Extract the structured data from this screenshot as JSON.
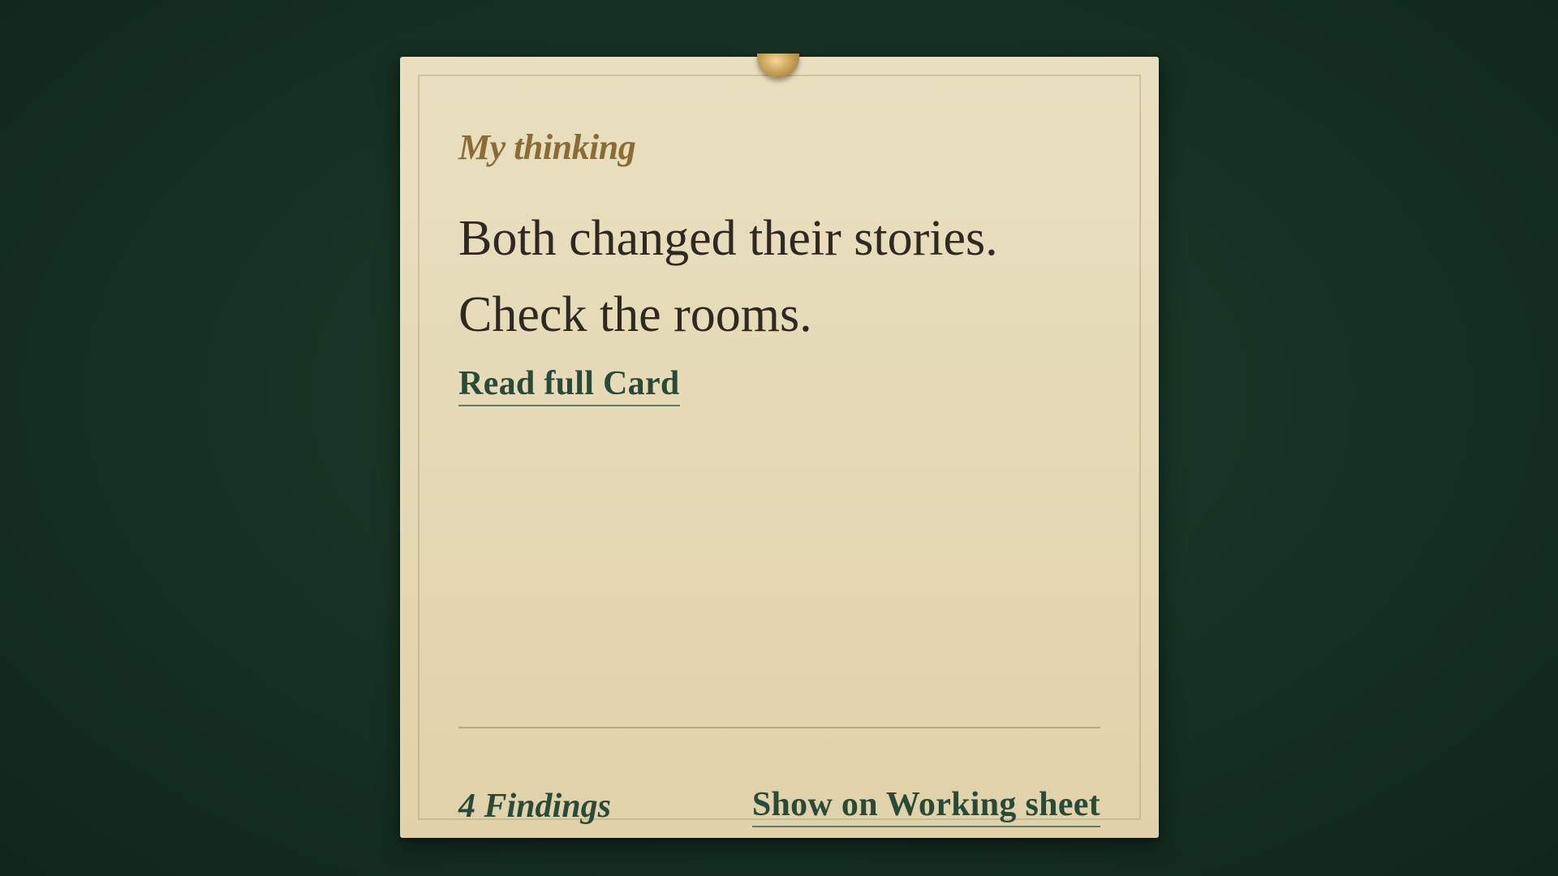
{
  "card": {
    "eyebrow": "My thinking",
    "headline": "Both changed their stories. Check the rooms.",
    "read_link": "Read full Card",
    "findings": "4 Findings",
    "sheet_link": "Show on Working sheet"
  },
  "colors": {
    "background": "#173325",
    "card": "#e5d9b5",
    "eyebrow": "#8a6c35",
    "text": "#2e2a22",
    "link": "#2a4a38",
    "pin": "#c9a45a"
  },
  "icons": {
    "pin": "pushpin-icon"
  }
}
